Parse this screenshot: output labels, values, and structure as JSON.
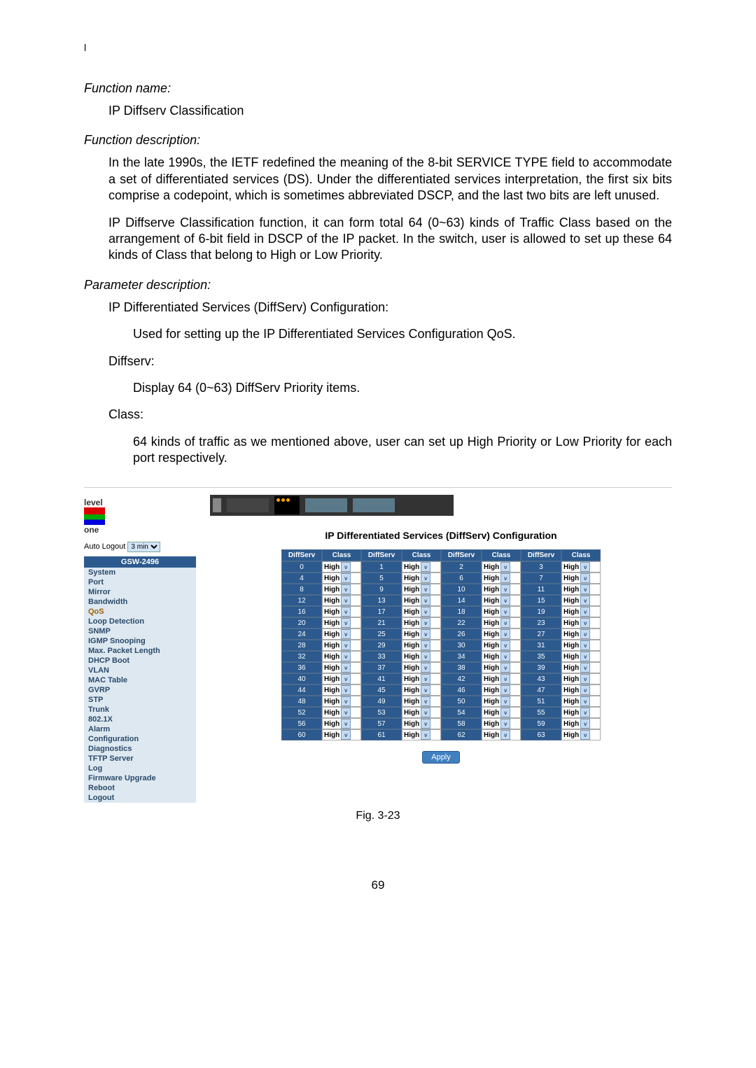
{
  "page_marker": "l",
  "labels": {
    "function_name": "Function name:",
    "function_description": "Function description:",
    "parameter_description": "Parameter description:"
  },
  "function_name_value": "IP Diffserv Classification",
  "desc_para1": "In the late 1990s, the IETF redefined the meaning of the 8-bit SERVICE TYPE field to accommodate a set of differentiated services (DS). Under the differentiated services interpretation, the first six bits comprise a codepoint, which is sometimes abbreviated DSCP, and the last two bits are left unused.",
  "desc_para2": "IP Diffserve Classification function, it can form total 64 (0~63) kinds of Traffic Class based on the arrangement of 6-bit field in DSCP of the IP packet.  In the switch, user is allowed to set up these 64 kinds of Class that belong to High or Low Priority.",
  "params": {
    "p1_title": "IP Differentiated Services (DiffServ) Configuration:",
    "p1_body": "Used for setting up the IP Differentiated Services Configuration QoS.",
    "p2_title": "Diffserv:",
    "p2_body": "Display 64 (0~63) DiffServ Priority items.",
    "p3_title": "Class:",
    "p3_body": "64 kinds of traffic as we mentioned above, user can set up High Priority or Low Priority for each port respectively."
  },
  "switch": {
    "logo_top": "level",
    "logo_bottom": "one",
    "auto_logout_label": "Auto Logout",
    "auto_logout_value": "3 min",
    "model": "GSW-2496",
    "sidebar_items": [
      "System",
      "Port",
      "Mirror",
      "Bandwidth",
      "QoS",
      "Loop Detection",
      "SNMP",
      "IGMP Snooping",
      "Max. Packet Length",
      "DHCP Boot",
      "VLAN",
      "MAC Table",
      "GVRP",
      "STP",
      "Trunk",
      "802.1X",
      "Alarm",
      "Configuration",
      "Diagnostics",
      "TFTP Server",
      "Log",
      "Firmware Upgrade",
      "Reboot",
      "Logout"
    ],
    "sidebar_active": "QoS",
    "config_title": "IP Differentiated Services (DiffServ) Configuration",
    "th_diffserv": "DiffServ",
    "th_class": "Class",
    "class_value": "High",
    "apply": "Apply"
  },
  "chart_data": {
    "type": "table",
    "title": "IP Differentiated Services (DiffServ) Configuration",
    "columns_repeating": [
      "DiffServ",
      "Class"
    ],
    "column_groups": 4,
    "rows": [
      [
        0,
        "High",
        1,
        "High",
        2,
        "High",
        3,
        "High"
      ],
      [
        4,
        "High",
        5,
        "High",
        6,
        "High",
        7,
        "High"
      ],
      [
        8,
        "High",
        9,
        "High",
        10,
        "High",
        11,
        "High"
      ],
      [
        12,
        "High",
        13,
        "High",
        14,
        "High",
        15,
        "High"
      ],
      [
        16,
        "High",
        17,
        "High",
        18,
        "High",
        19,
        "High"
      ],
      [
        20,
        "High",
        21,
        "High",
        22,
        "High",
        23,
        "High"
      ],
      [
        24,
        "High",
        25,
        "High",
        26,
        "High",
        27,
        "High"
      ],
      [
        28,
        "High",
        29,
        "High",
        30,
        "High",
        31,
        "High"
      ],
      [
        32,
        "High",
        33,
        "High",
        34,
        "High",
        35,
        "High"
      ],
      [
        36,
        "High",
        37,
        "High",
        38,
        "High",
        39,
        "High"
      ],
      [
        40,
        "High",
        41,
        "High",
        42,
        "High",
        43,
        "High"
      ],
      [
        44,
        "High",
        45,
        "High",
        46,
        "High",
        47,
        "High"
      ],
      [
        48,
        "High",
        49,
        "High",
        50,
        "High",
        51,
        "High"
      ],
      [
        52,
        "High",
        53,
        "High",
        54,
        "High",
        55,
        "High"
      ],
      [
        56,
        "High",
        57,
        "High",
        58,
        "High",
        59,
        "High"
      ],
      [
        60,
        "High",
        61,
        "High",
        62,
        "High",
        63,
        "High"
      ]
    ]
  },
  "fig_caption": "Fig. 3-23",
  "page_number": "69"
}
